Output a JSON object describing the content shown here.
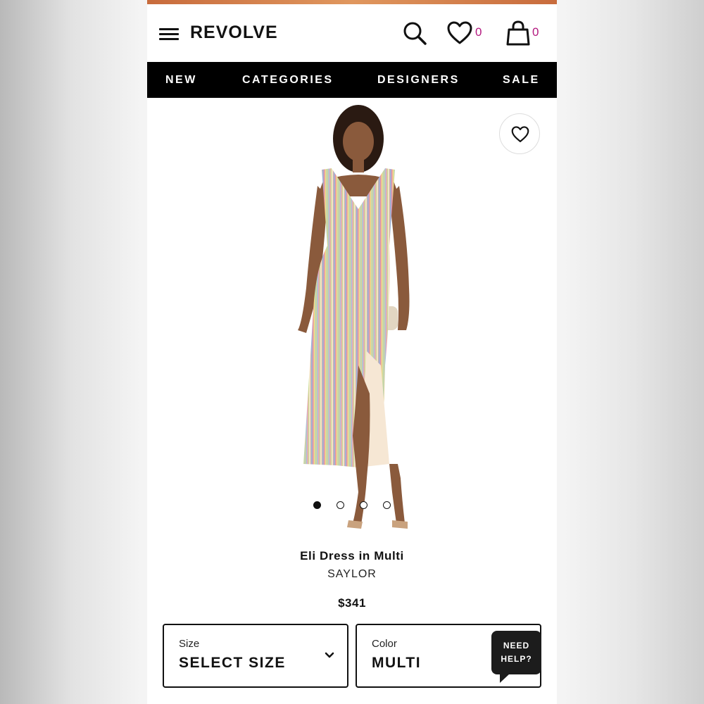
{
  "header": {
    "logo": "REVOLVE",
    "wishlist_count": "0",
    "bag_count": "0",
    "accent_color": "#b3197f"
  },
  "nav": {
    "items": [
      "NEW",
      "CATEGORIES",
      "DESIGNERS",
      "SALE"
    ]
  },
  "gallery": {
    "image_count": 4,
    "active_index": 0
  },
  "product": {
    "name": "Eli Dress in Multi",
    "brand": "SAYLOR",
    "price": "$341"
  },
  "selectors": {
    "size_label": "Size",
    "size_value": "SELECT SIZE",
    "color_label": "Color",
    "color_value": "MULTI"
  },
  "help": {
    "line1": "NEED",
    "line2": "HELP?"
  }
}
